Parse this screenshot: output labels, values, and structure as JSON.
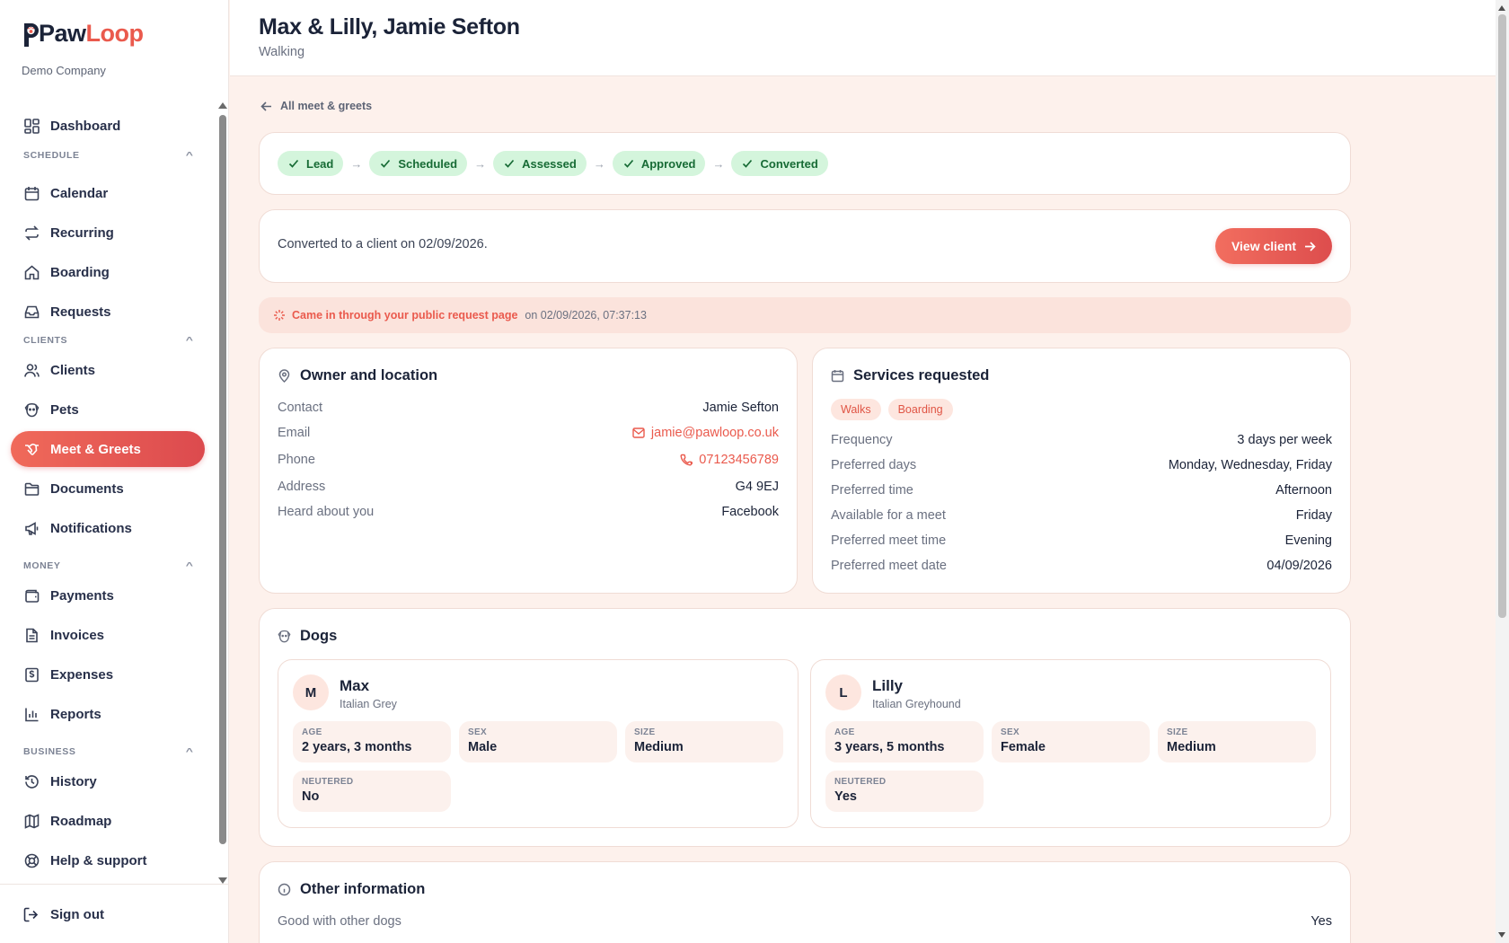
{
  "brand": {
    "name_part1": "Paw",
    "name_part2": "Loop",
    "company": "Demo Company"
  },
  "sidebar": {
    "dashboard": "Dashboard",
    "sections": {
      "schedule": "SCHEDULE",
      "clients": "CLIENTS",
      "money": "MONEY",
      "business": "BUSINESS"
    },
    "items": {
      "calendar": "Calendar",
      "recurring": "Recurring",
      "boarding": "Boarding",
      "requests": "Requests",
      "clients": "Clients",
      "pets": "Pets",
      "meet_greets": "Meet & Greets",
      "documents": "Documents",
      "notifications": "Notifications",
      "payments": "Payments",
      "invoices": "Invoices",
      "expenses": "Expenses",
      "reports": "Reports",
      "history": "History",
      "roadmap": "Roadmap",
      "help": "Help & support"
    },
    "active": "meet_greets",
    "sign_out": "Sign out"
  },
  "header": {
    "title": "Max & Lilly, Jamie Sefton",
    "subtitle": "Walking"
  },
  "back_link": "All meet & greets",
  "pipeline": {
    "steps": [
      "Lead",
      "Scheduled",
      "Assessed",
      "Approved",
      "Converted"
    ],
    "arrow": "→"
  },
  "conversion": {
    "text": "Converted to a client on 02/09/2026.",
    "button": "View client"
  },
  "source": {
    "label": "Came in through your public request page",
    "when": "on 02/09/2026, 07:37:13"
  },
  "owner": {
    "title": "Owner and location",
    "rows": [
      {
        "k": "Contact",
        "v": "Jamie Sefton"
      },
      {
        "k": "Email",
        "v": "jamie@pawloop.co.uk"
      },
      {
        "k": "Phone",
        "v": "07123456789"
      },
      {
        "k": "Address",
        "v": "G4 9EJ"
      },
      {
        "k": "Heard about you",
        "v": "Facebook"
      }
    ]
  },
  "services": {
    "title": "Services requested",
    "tags": [
      "Walks",
      "Boarding"
    ],
    "rows": [
      {
        "k": "Frequency",
        "v": "3 days per week"
      },
      {
        "k": "Preferred days",
        "v": "Monday, Wednesday, Friday"
      },
      {
        "k": "Preferred time",
        "v": "Afternoon"
      },
      {
        "k": "Available for a meet",
        "v": "Friday"
      },
      {
        "k": "Preferred meet time",
        "v": "Evening"
      },
      {
        "k": "Preferred meet date",
        "v": "04/09/2026"
      }
    ]
  },
  "dogs": {
    "title": "Dogs",
    "list": [
      {
        "initial": "M",
        "name": "Max",
        "breed": "Italian Grey",
        "age_label": "AGE",
        "age": "2 years, 3 months",
        "sex_label": "SEX",
        "sex": "Male",
        "size_label": "SIZE",
        "size": "Medium",
        "neutered_label": "NEUTERED",
        "neutered": "No"
      },
      {
        "initial": "L",
        "name": "Lilly",
        "breed": "Italian Greyhound",
        "age_label": "AGE",
        "age": "3 years, 5 months",
        "sex_label": "SEX",
        "sex": "Female",
        "size_label": "SIZE",
        "size": "Medium",
        "neutered_label": "NEUTERED",
        "neutered": "Yes"
      }
    ]
  },
  "other": {
    "title": "Other information",
    "rows": [
      {
        "k": "Good with other dogs",
        "v": "Yes"
      }
    ]
  },
  "colors": {
    "accent": "#ea5a4d",
    "step_bg": "#d4f5dc",
    "step_text": "#176b35",
    "page_bg": "#fdf1ec"
  }
}
